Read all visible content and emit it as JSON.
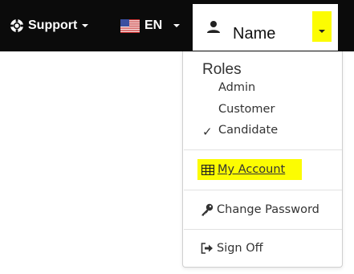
{
  "topbar": {
    "support_label": "Support",
    "language_label": "EN",
    "user_name": "Name"
  },
  "menu": {
    "roles_heading": "Roles",
    "roles": [
      "Admin",
      "Customer",
      "Candidate"
    ],
    "selected_role": "Candidate",
    "my_account": "My Account",
    "change_password": "Change Password",
    "sign_off": "Sign Off"
  },
  "colors": {
    "topbar_bg": "#0b0b0b",
    "highlight": "#fcfc02",
    "text": "#333333"
  },
  "icons": {
    "support": "lifebuoy-icon",
    "language": "us-flag-icon",
    "user": "user-icon",
    "account": "table-icon",
    "password": "key-icon",
    "sign_off": "sign-out-icon",
    "check": "check-icon"
  }
}
